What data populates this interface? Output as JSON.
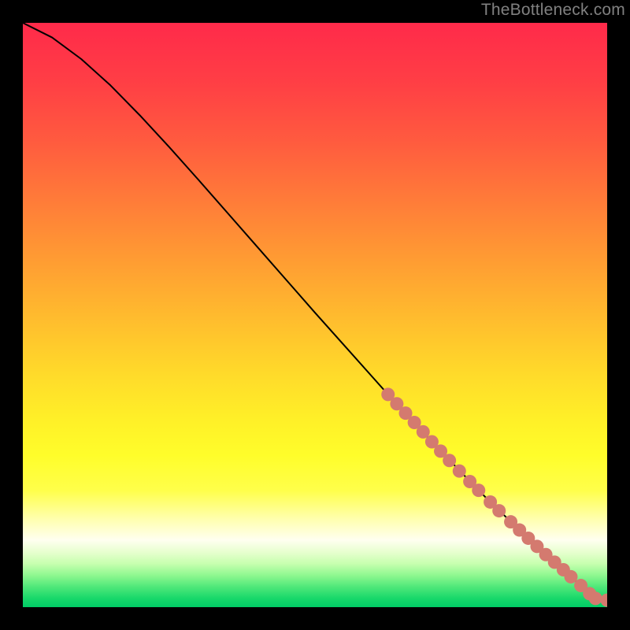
{
  "attribution": "TheBottleneck.com",
  "chart_data": {
    "type": "line",
    "title": "",
    "xlabel": "",
    "ylabel": "",
    "xlim": [
      0,
      100
    ],
    "ylim": [
      0,
      100
    ],
    "grid": false,
    "series": [
      {
        "name": "curve",
        "x": [
          0,
          5,
          10,
          15,
          20,
          25,
          30,
          35,
          40,
          45,
          50,
          55,
          60,
          62.5,
          65,
          67.5,
          70,
          72.5,
          75,
          77.5,
          80,
          82.5,
          85,
          87.5,
          90,
          92.5,
          94.7,
          96.5,
          98,
          100
        ],
        "y": [
          100,
          97.5,
          93.8,
          89.3,
          84.2,
          78.8,
          73.2,
          67.5,
          61.8,
          56.1,
          50.4,
          44.8,
          39.2,
          36.4,
          33.7,
          31.0,
          28.3,
          25.7,
          23.1,
          20.5,
          18.0,
          15.6,
          13.2,
          10.9,
          8.6,
          6.4,
          4.4,
          2.7,
          1.5,
          1.2
        ]
      }
    ],
    "markers": {
      "name": "highlighted-points",
      "color": "#d47a6f",
      "points": [
        {
          "x": 62.5,
          "y": 36.4
        },
        {
          "x": 64.0,
          "y": 34.8
        },
        {
          "x": 65.5,
          "y": 33.2
        },
        {
          "x": 67.0,
          "y": 31.6
        },
        {
          "x": 68.5,
          "y": 30.0
        },
        {
          "x": 70.0,
          "y": 28.3
        },
        {
          "x": 71.5,
          "y": 26.7
        },
        {
          "x": 73.0,
          "y": 25.1
        },
        {
          "x": 74.7,
          "y": 23.3
        },
        {
          "x": 76.5,
          "y": 21.5
        },
        {
          "x": 78.0,
          "y": 20.0
        },
        {
          "x": 80.0,
          "y": 18.0
        },
        {
          "x": 81.5,
          "y": 16.5
        },
        {
          "x": 83.5,
          "y": 14.6
        },
        {
          "x": 85.0,
          "y": 13.2
        },
        {
          "x": 86.5,
          "y": 11.8
        },
        {
          "x": 88.0,
          "y": 10.4
        },
        {
          "x": 89.5,
          "y": 9.0
        },
        {
          "x": 91.0,
          "y": 7.7
        },
        {
          "x": 92.5,
          "y": 6.4
        },
        {
          "x": 93.8,
          "y": 5.2
        },
        {
          "x": 95.5,
          "y": 3.7
        },
        {
          "x": 97.0,
          "y": 2.3
        },
        {
          "x": 98.0,
          "y": 1.5
        },
        {
          "x": 100.0,
          "y": 1.2
        }
      ]
    },
    "background_gradient": {
      "stops": [
        {
          "pos": 0.0,
          "color": "#ff2a4a"
        },
        {
          "pos": 0.1,
          "color": "#ff3e45"
        },
        {
          "pos": 0.2,
          "color": "#ff5a3f"
        },
        {
          "pos": 0.3,
          "color": "#ff7a39"
        },
        {
          "pos": 0.4,
          "color": "#ff9a33"
        },
        {
          "pos": 0.5,
          "color": "#ffba2e"
        },
        {
          "pos": 0.6,
          "color": "#ffda2a"
        },
        {
          "pos": 0.68,
          "color": "#fff028"
        },
        {
          "pos": 0.74,
          "color": "#fffd2a"
        },
        {
          "pos": 0.8,
          "color": "#ffff4a"
        },
        {
          "pos": 0.85,
          "color": "#ffffb0"
        },
        {
          "pos": 0.885,
          "color": "#fffff0"
        },
        {
          "pos": 0.905,
          "color": "#e8ffd0"
        },
        {
          "pos": 0.925,
          "color": "#c8ffb0"
        },
        {
          "pos": 0.945,
          "color": "#90f890"
        },
        {
          "pos": 0.965,
          "color": "#50e87a"
        },
        {
          "pos": 0.985,
          "color": "#18d86a"
        },
        {
          "pos": 1.0,
          "color": "#00cd66"
        }
      ]
    }
  }
}
